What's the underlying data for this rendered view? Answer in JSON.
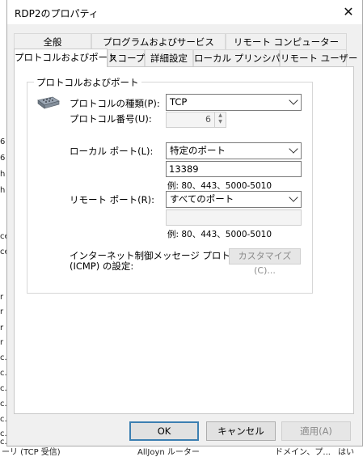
{
  "window": {
    "title": "RDP2のプロパティ",
    "close_symbol": "✕"
  },
  "tabs_row1": [
    {
      "label": "全般"
    },
    {
      "label": "プログラムおよびサービス"
    },
    {
      "label": "リモート コンピューター"
    }
  ],
  "tabs_row2": [
    {
      "label": "プロトコルおよびポート",
      "active": true
    },
    {
      "label": "スコープ"
    },
    {
      "label": "詳細設定"
    },
    {
      "label": "ローカル プリンシパル"
    },
    {
      "label": "リモート ユーザー"
    }
  ],
  "group": {
    "legend": "プロトコルおよびポート",
    "protocol_type_label": "プロトコルの種類(P):",
    "protocol_type_value": "TCP",
    "protocol_number_label": "プロトコル番号(U):",
    "protocol_number_value": "6",
    "local_port_label": "ローカル ポート(L):",
    "local_port_value": "特定のポート",
    "local_port_text": "13389",
    "local_port_example": "例: 80、443、5000-5010",
    "remote_port_label": "リモート ポート(R):",
    "remote_port_value": "すべてのポート",
    "remote_port_text": "",
    "remote_port_example": "例: 80、443、5000-5010",
    "icmp_label_line1": "インターネット制御メッセージ プロトコル",
    "icmp_label_line2": "(ICMP) の設定:",
    "customize_button": "カスタマイズ(C)..."
  },
  "buttons": {
    "ok": "OK",
    "cancel": "キャンセル",
    "apply": "適用(A)"
  },
  "background": {
    "left_fragments": [
      "6",
      "6",
      "h",
      "h",
      "ce",
      "ce",
      "r",
      "r",
      "r",
      "r",
      "c.A",
      "c.A",
      "c.N",
      "c.V",
      "c.V",
      "c.V",
      "c.V"
    ],
    "bottom_left": "ーリ (TCP 受信)",
    "bottom_mid": "AllJoyn ルーター",
    "bottom_right1": "ドメイン、プ...",
    "bottom_right2": "はい"
  },
  "colors": {
    "dialog_bg": "#f0f0f0",
    "default_button_border": "#3c7fb1"
  }
}
